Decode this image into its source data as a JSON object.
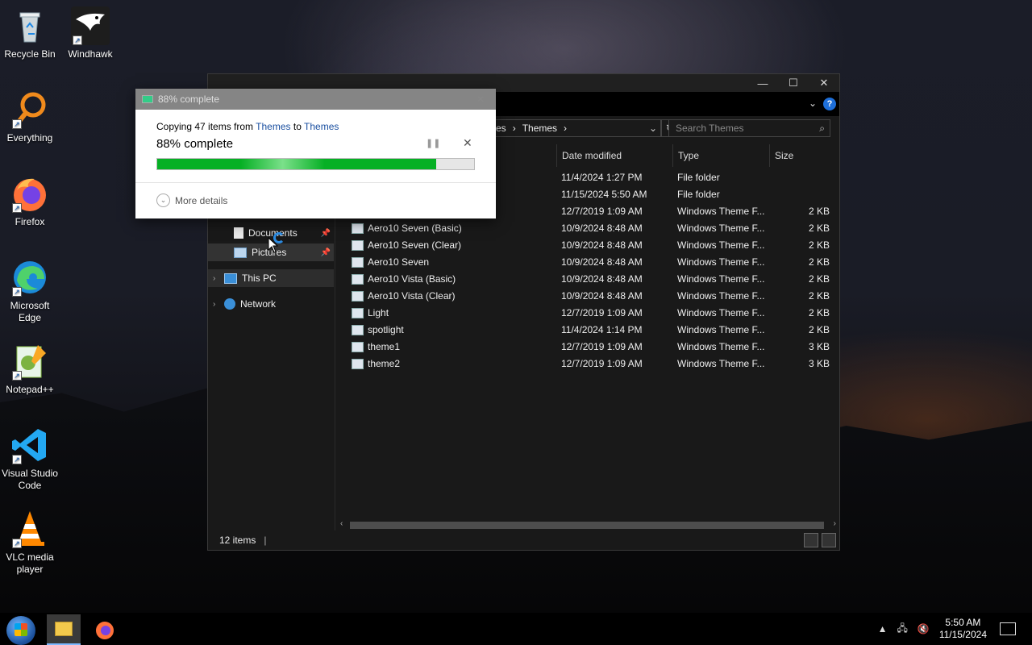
{
  "desktop": {
    "icons": [
      {
        "label": "Recycle Bin",
        "icon": "recycle-bin-icon"
      },
      {
        "label": "Windhawk",
        "icon": "windhawk-icon"
      },
      {
        "label": "Everything",
        "icon": "everything-icon"
      },
      {
        "label": "Firefox",
        "icon": "firefox-icon"
      },
      {
        "label": "Microsoft Edge",
        "icon": "edge-icon"
      },
      {
        "label": "Notepad++",
        "icon": "notepadpp-icon"
      },
      {
        "label": "Visual Studio Code",
        "icon": "vscode-icon"
      },
      {
        "label": "VLC media player",
        "icon": "vlc-icon"
      }
    ]
  },
  "explorer": {
    "title": "Themes",
    "address": {
      "segment_partial": "es",
      "segment": "Themes"
    },
    "search_placeholder": "Search Themes",
    "nav": {
      "documents": "Documents",
      "pictures": "Pictures",
      "this_pc": "This PC",
      "network": "Network"
    },
    "columns": {
      "date": "Date modified",
      "type": "Type",
      "size": "Size"
    },
    "rows": [
      {
        "name": "",
        "date": "11/4/2024 1:27 PM",
        "type": "File folder",
        "size": ""
      },
      {
        "name": "",
        "date": "11/15/2024 5:50 AM",
        "type": "File folder",
        "size": ""
      },
      {
        "name": "",
        "date": "12/7/2019 1:09 AM",
        "type": "Windows Theme F...",
        "size": "2 KB"
      },
      {
        "name": "Aero10 Seven (Basic)",
        "date": "10/9/2024 8:48 AM",
        "type": "Windows Theme F...",
        "size": "2 KB"
      },
      {
        "name": "Aero10 Seven (Clear)",
        "date": "10/9/2024 8:48 AM",
        "type": "Windows Theme F...",
        "size": "2 KB"
      },
      {
        "name": "Aero10 Seven",
        "date": "10/9/2024 8:48 AM",
        "type": "Windows Theme F...",
        "size": "2 KB"
      },
      {
        "name": "Aero10 Vista (Basic)",
        "date": "10/9/2024 8:48 AM",
        "type": "Windows Theme F...",
        "size": "2 KB"
      },
      {
        "name": "Aero10 Vista (Clear)",
        "date": "10/9/2024 8:48 AM",
        "type": "Windows Theme F...",
        "size": "2 KB"
      },
      {
        "name": "Light",
        "date": "12/7/2019 1:09 AM",
        "type": "Windows Theme F...",
        "size": "2 KB"
      },
      {
        "name": "spotlight",
        "date": "11/4/2024 1:14 PM",
        "type": "Windows Theme F...",
        "size": "2 KB"
      },
      {
        "name": "theme1",
        "date": "12/7/2019 1:09 AM",
        "type": "Windows Theme F...",
        "size": "3 KB"
      },
      {
        "name": "theme2",
        "date": "12/7/2019 1:09 AM",
        "type": "Windows Theme F...",
        "size": "3 KB"
      }
    ],
    "status": "12 items"
  },
  "progress_dialog": {
    "title": "88% complete",
    "copy_prefix": "Copying 47 items from",
    "from": "Themes",
    "to_word": "to",
    "to": "Themes",
    "percent_text": "88% complete",
    "progress": 0.88,
    "more_details": "More details"
  },
  "taskbar": {
    "time": "5:50 AM",
    "date": "11/15/2024"
  },
  "colors": {
    "progress_green": "#06b025",
    "link_blue": "#1a4fa0",
    "explorer_bg": "#191919"
  }
}
